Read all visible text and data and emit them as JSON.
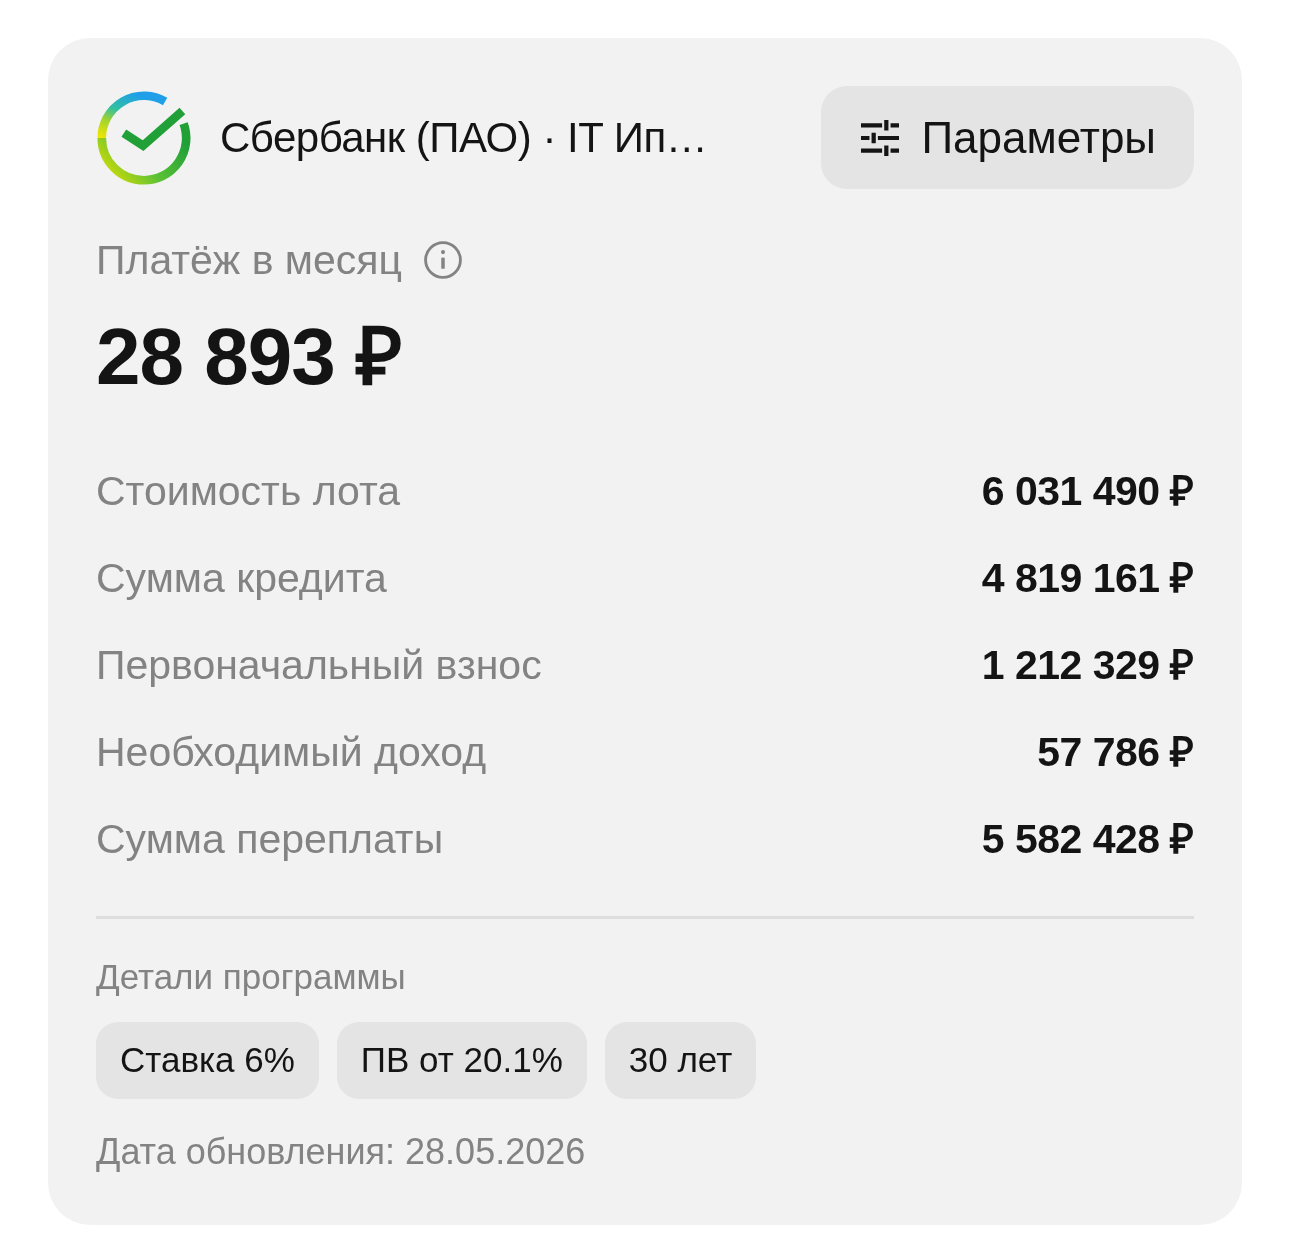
{
  "header": {
    "bank_name": "Сбербанк (ПАО) · IT Ип…",
    "params_button": "Параметры"
  },
  "payment": {
    "label": "Платёж в месяц",
    "amount": "28 893 ₽"
  },
  "rows": [
    {
      "label": "Стоимость лота",
      "value": "6 031 490 ₽"
    },
    {
      "label": "Сумма кредита",
      "value": "4 819 161 ₽"
    },
    {
      "label": "Первоначальный взнос",
      "value": "1 212 329 ₽"
    },
    {
      "label": "Необходимый доход",
      "value": "57 786 ₽"
    },
    {
      "label": "Сумма переплаты",
      "value": "5 582 428 ₽"
    }
  ],
  "program": {
    "title": "Детали программы",
    "chips": [
      "Ставка 6%",
      "ПВ от 20.1%",
      "30 лет"
    ]
  },
  "updated": "Дата обновления: 28.05.2026"
}
